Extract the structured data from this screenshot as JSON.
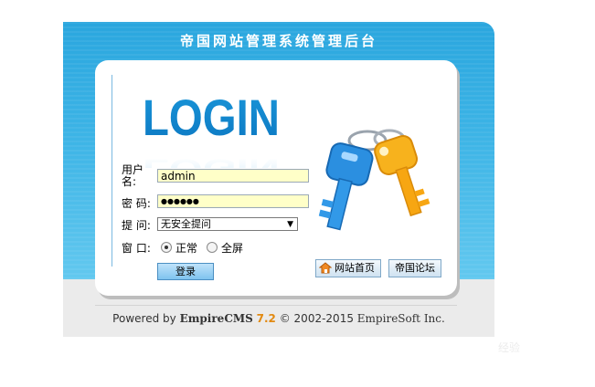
{
  "header": {
    "title": "帝国网站管理系统管理后台"
  },
  "logo": {
    "text": "LOGIN"
  },
  "form": {
    "username_label": "用户名:",
    "username_value": "admin",
    "password_label": "密  码:",
    "password_mask": "●●●●●●",
    "question_label": "提  问:",
    "question_selected": "无安全提问",
    "window_label": "窗  口:",
    "window_options": [
      "正常",
      "全屏"
    ],
    "window_selected": "正常",
    "login_button": "登录",
    "home_button": "网站首页",
    "forum_button": "帝国论坛"
  },
  "footer": {
    "powered_by": "Powered by",
    "brand": "EmpireCMS",
    "version": "7.2",
    "copyright": "© 2002-2015",
    "company": "EmpireSoft Inc."
  },
  "watermark": {
    "text": "经验"
  },
  "colors": {
    "panel_blue": "#2aa6de",
    "field_yellow": "#ffffc8",
    "version_orange": "#e28a12"
  },
  "icons": [
    "login-logo",
    "keys-illustration",
    "home-icon",
    "dropdown-arrow-icon"
  ]
}
